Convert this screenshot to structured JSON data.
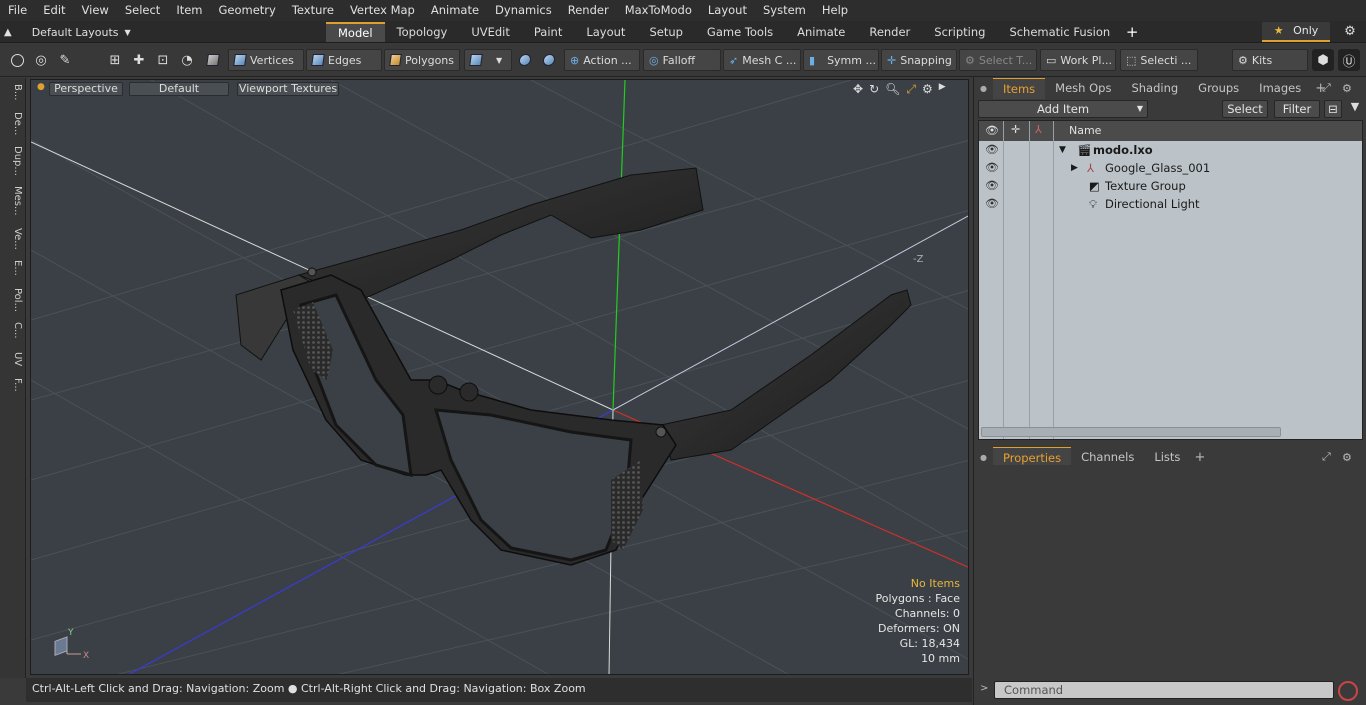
{
  "menu": [
    "File",
    "Edit",
    "View",
    "Select",
    "Item",
    "Geometry",
    "Texture",
    "Vertex Map",
    "Animate",
    "Dynamics",
    "Render",
    "MaxToModo",
    "Layout",
    "System",
    "Help"
  ],
  "tabbar": {
    "layouts_label": "Default Layouts",
    "tabs": [
      "Model",
      "Topology",
      "UVEdit",
      "Paint",
      "Layout",
      "Setup",
      "Game Tools",
      "Animate",
      "Render",
      "Scripting",
      "Schematic Fusion"
    ],
    "active_tab": "Model",
    "only_label": "Only"
  },
  "toolbar": {
    "vertices": "Vertices",
    "edges": "Edges",
    "polygons": "Polygons",
    "action": "Action ...",
    "falloff": "Falloff",
    "mesh": "Mesh C ...",
    "symm": "Symm ...",
    "snapping": "Snapping",
    "select_t": "Select T...",
    "work_pl": "Work Pl...",
    "selecti": "Selecti ...",
    "kits": "Kits"
  },
  "leftbar": [
    "B...",
    "De...",
    "Dup...",
    "Mes...",
    "Ve...",
    "E...",
    "Pol...",
    "C...",
    "UV",
    "F..."
  ],
  "viewport": {
    "perspective": "Perspective",
    "default": "Default",
    "textures": "Viewport Textures",
    "hud": {
      "status": "No Items",
      "polygons": "Polygons : Face",
      "channels": "Channels: 0",
      "deformers": "Deformers: ON",
      "gl": "GL: 18,434",
      "unit": "10 mm"
    },
    "axis_y": "Y",
    "axis_x": "X",
    "axis_minus_z": "-Z"
  },
  "status_text": "Ctrl-Alt-Left Click and Drag: Navigation: Zoom ● Ctrl-Alt-Right Click and Drag: Navigation: Box Zoom",
  "items_panel": {
    "tabs": [
      "Items",
      "Mesh Ops",
      "Shading",
      "Groups",
      "Images"
    ],
    "add_item": "Add Item",
    "select": "Select",
    "filter": "Filter",
    "name_col": "Name",
    "rows": [
      {
        "label": "modo.lxo"
      },
      {
        "label": "Google_Glass_001"
      },
      {
        "label": "Texture Group"
      },
      {
        "label": "Directional Light"
      }
    ]
  },
  "props_panel": {
    "tabs": [
      "Properties",
      "Channels",
      "Lists"
    ]
  },
  "command_placeholder": "Command",
  "colors": {
    "accent": "#e0a030",
    "viewport_bg": "#3a4045",
    "grid": "#4e565c"
  }
}
